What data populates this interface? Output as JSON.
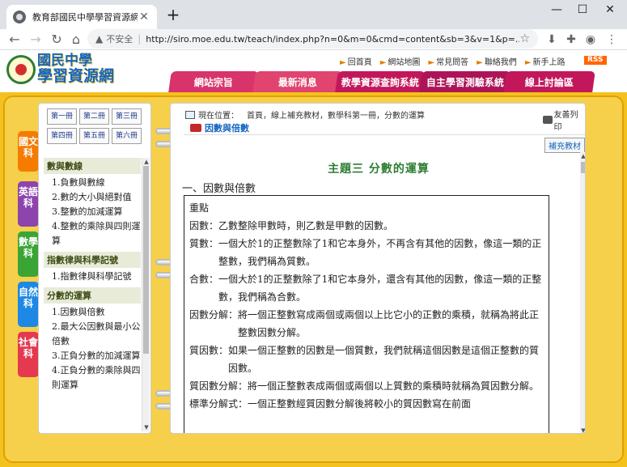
{
  "browser": {
    "tab_title": "教育部國民中學學習資源網",
    "tab_close": "✕",
    "new_tab": "+",
    "insecure_label": "不安全",
    "url": "http://siro.moe.edu.tw/teach/index.php?n=0&m=0&cmd=content&sb=3&v=1&p=..."
  },
  "header": {
    "logo_line1": "國民中學",
    "logo_line2": "學習資源網",
    "top_links": [
      "回首頁",
      "網站地圖",
      "常見問答",
      "聯絡我們",
      "新手上路"
    ],
    "rss": "RSS",
    "nav_tabs": [
      {
        "label": "網站宗旨",
        "color": "#d8336b"
      },
      {
        "label": "最新消息",
        "color": "#d8336b"
      },
      {
        "label": "教學資源查詢系統",
        "color": "#c2185b"
      },
      {
        "label": "自主學習測驗系統",
        "color": "#ad1457"
      },
      {
        "label": "線上討論區",
        "color": "#c2185b"
      }
    ]
  },
  "subjects": [
    {
      "label": "國文科",
      "color": "#f57c00"
    },
    {
      "label": "英語科",
      "color": "#8e44ad"
    },
    {
      "label": "數學科",
      "color": "#3aa535"
    },
    {
      "label": "自然科",
      "color": "#1e88e5"
    },
    {
      "label": "社會科",
      "color": "#e53950"
    }
  ],
  "books": [
    "第一冊",
    "第二冊",
    "第三冊",
    "第四冊",
    "第五冊",
    "第六冊"
  ],
  "sidebar": {
    "sections": [
      {
        "title": "數與數線",
        "items": [
          "1.負數與數線",
          "2.數的大小與絕對值",
          "3.整數的加減運算",
          "4.整數的乘除與四則運算"
        ]
      },
      {
        "title": "指數律與科學記號",
        "items": [
          "1.指數律與科學記號"
        ]
      },
      {
        "title": "分數的運算",
        "items": [
          "1.因數與倍數",
          "2.最大公因數與最小公倍數",
          "3.正負分數的加減運算",
          "4.正負分數的乘除與四則運算"
        ]
      }
    ]
  },
  "content": {
    "location_label": "現在位置：",
    "breadcrumb": "首頁，線上補充教材，數學科第一冊，分數的運算",
    "print_label": "友善列印",
    "section_title": "因數與倍數",
    "supplement_btn": "補充教材",
    "topic_title": "主題三 分數的運算",
    "subheading": "一、因數與倍數",
    "box_title": "重點",
    "definitions": [
      {
        "term": "因數：",
        "desc": "乙數整除甲數時，則乙數是甲數的因數。"
      },
      {
        "term": "質數：",
        "desc": "一個大於1的正整數除了1和它本身外，不再含有其他的因數，像這一類的正整數，我們稱為質數。"
      },
      {
        "term": "合數：",
        "desc": "一個大於1的正整數除了1和它本身外，還含有其他的因數，像這一類的正整數，我們稱為合數。"
      },
      {
        "term": "因數分解：",
        "desc": "將一個正整數寫成兩個或兩個以上比它小的正數的乘積，就稱為將此正整數因數分解。"
      },
      {
        "term": "質因數：",
        "desc": "如果一個正整數的因數是一個質數，我們就稱這個因數是這個正整數的質因數。"
      },
      {
        "term": "質因數分解：",
        "desc": "將一個正整數表成兩個或兩個以上質數的乘積時就稱為質因數分解。"
      },
      {
        "term": "標準分解式：",
        "desc": "一個正整數經質因數分解後將較小的質因數寫在前面"
      }
    ]
  }
}
